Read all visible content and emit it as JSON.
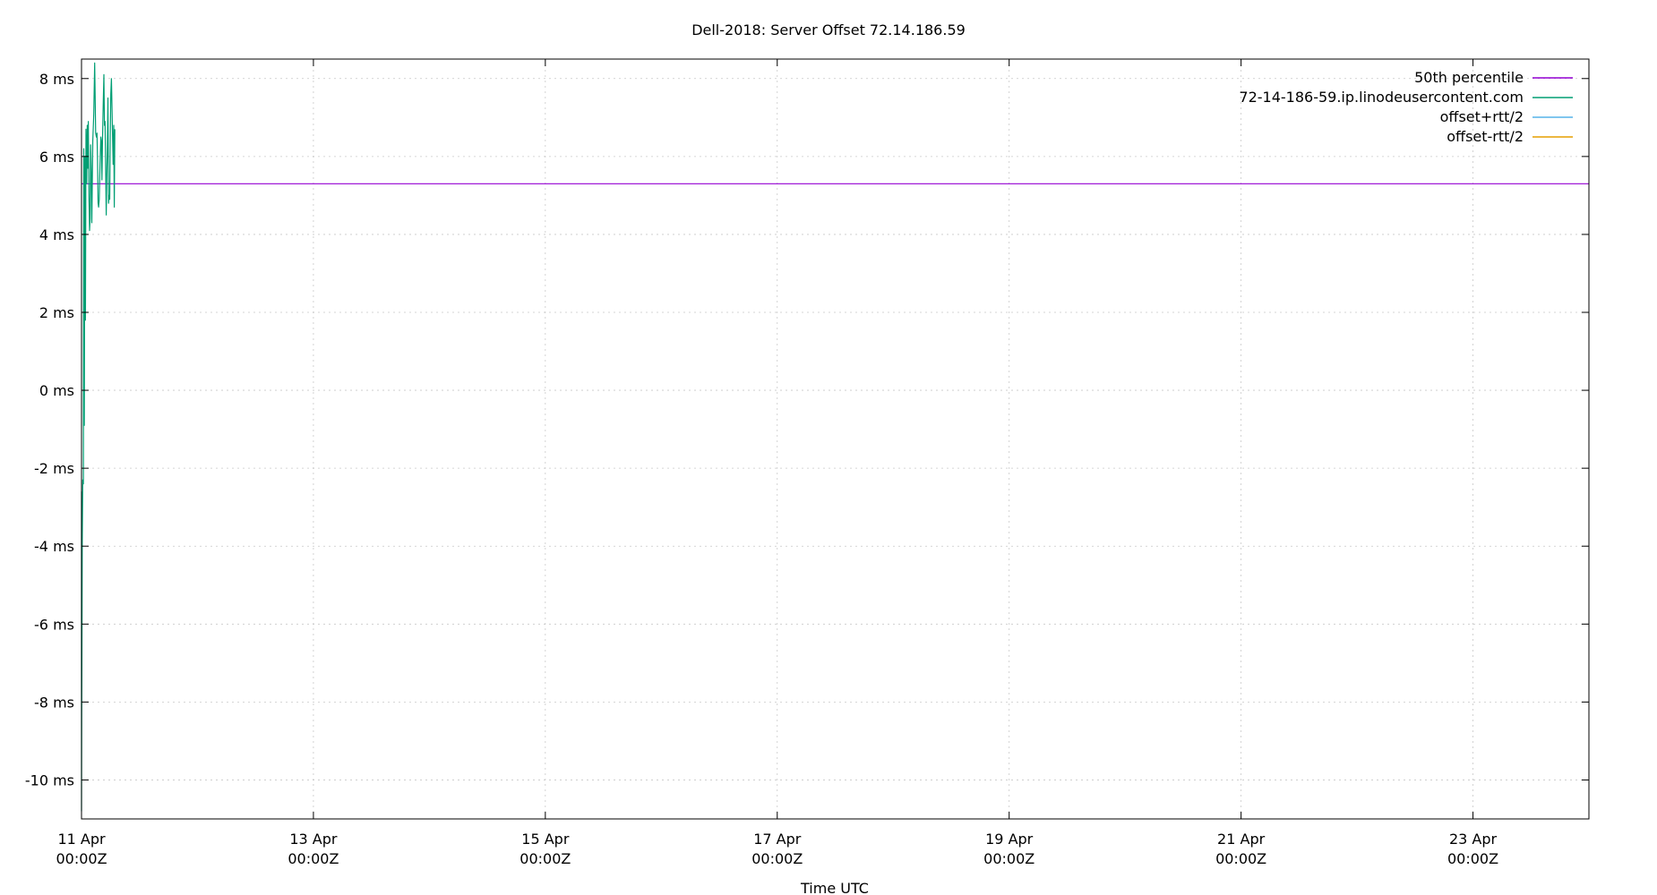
{
  "chart_data": {
    "type": "line",
    "title": "Dell-2018: Server Offset 72.14.186.59",
    "xlabel": "Time UTC",
    "ylabel": "",
    "xlim": [
      "2023-04-11 00:00",
      "2023-04-24 00:00"
    ],
    "ylim": [
      -11,
      8.5
    ],
    "grid": true,
    "legend_position": "top-right",
    "y_ticks": [
      {
        "value": 8,
        "label": "8 ms"
      },
      {
        "value": 6,
        "label": "6 ms"
      },
      {
        "value": 4,
        "label": "4 ms"
      },
      {
        "value": 2,
        "label": "2 ms"
      },
      {
        "value": 0,
        "label": "0 ms"
      },
      {
        "value": -2,
        "label": "-2 ms"
      },
      {
        "value": -4,
        "label": "-4 ms"
      },
      {
        "value": -6,
        "label": "-6 ms"
      },
      {
        "value": -8,
        "label": "-8 ms"
      },
      {
        "value": -10,
        "label": "-10 ms"
      }
    ],
    "x_ticks": [
      {
        "value": "2023-04-11 00:00",
        "line1": "11 Apr",
        "line2": "00:00Z"
      },
      {
        "value": "2023-04-13 00:00",
        "line1": "13 Apr",
        "line2": "00:00Z"
      },
      {
        "value": "2023-04-15 00:00",
        "line1": "15 Apr",
        "line2": "00:00Z"
      },
      {
        "value": "2023-04-17 00:00",
        "line1": "17 Apr",
        "line2": "00:00Z"
      },
      {
        "value": "2023-04-19 00:00",
        "line1": "19 Apr",
        "line2": "00:00Z"
      },
      {
        "value": "2023-04-21 00:00",
        "line1": "21 Apr",
        "line2": "00:00Z"
      },
      {
        "value": "2023-04-23 00:00",
        "line1": "23 Apr",
        "line2": "00:00Z"
      }
    ],
    "series": [
      {
        "name": "50th percentile",
        "color": "#9400d3",
        "style": "hline",
        "value": 5.3
      },
      {
        "name": "72-14-186-59.ip.linodeusercontent.com",
        "color": "#009e73",
        "style": "line",
        "points": [
          [
            "2023-04-10 22:58",
            -6.0
          ],
          [
            "2023-04-10 23:05",
            -8.6
          ],
          [
            "2023-04-10 23:12",
            -6.6
          ],
          [
            "2023-04-10 23:19",
            -3.4
          ],
          [
            "2023-04-10 23:26",
            -3.0
          ],
          [
            "2023-04-10 23:33",
            -2.6
          ],
          [
            "2023-04-10 23:40",
            -6.3
          ],
          [
            "2023-04-10 23:47",
            -6.5
          ],
          [
            "2023-04-10 23:54",
            -10.8
          ],
          [
            "2023-04-11 00:02",
            -8.5
          ],
          [
            "2023-04-11 00:09",
            -4.0
          ],
          [
            "2023-04-11 00:16",
            -2.3
          ],
          [
            "2023-04-11 00:23",
            -2.4
          ],
          [
            "2023-04-11 00:28",
            6.2
          ],
          [
            "2023-04-11 00:35",
            -0.9
          ],
          [
            "2023-04-11 00:42",
            6.0
          ],
          [
            "2023-04-11 00:49",
            1.8
          ],
          [
            "2023-04-11 00:56",
            6.7
          ],
          [
            "2023-04-11 01:04",
            5.3
          ],
          [
            "2023-04-11 01:11",
            6.8
          ],
          [
            "2023-04-11 01:18",
            5.7
          ],
          [
            "2023-04-11 01:25",
            6.9
          ],
          [
            "2023-04-11 01:32",
            5.0
          ],
          [
            "2023-04-11 01:40",
            4.1
          ],
          [
            "2023-04-11 01:47",
            4.4
          ],
          [
            "2023-04-11 01:54",
            6.3
          ],
          [
            "2023-04-11 02:01",
            5.6
          ],
          [
            "2023-04-11 02:08",
            4.3
          ],
          [
            "2023-04-11 02:20",
            6.4
          ],
          [
            "2023-04-11 02:32",
            7.1
          ],
          [
            "2023-04-11 02:44",
            8.4
          ],
          [
            "2023-04-11 02:56",
            6.6
          ],
          [
            "2023-04-11 03:05",
            6.5
          ],
          [
            "2023-04-11 03:12",
            6.6
          ],
          [
            "2023-04-11 03:19",
            5.9
          ],
          [
            "2023-04-11 03:26",
            4.8
          ],
          [
            "2023-04-11 03:33",
            4.7
          ],
          [
            "2023-04-11 03:40",
            4.9
          ],
          [
            "2023-04-11 03:50",
            5.8
          ],
          [
            "2023-04-11 04:00",
            6.5
          ],
          [
            "2023-04-11 04:07",
            6.4
          ],
          [
            "2023-04-11 04:14",
            5.4
          ],
          [
            "2023-04-11 04:21",
            6.5
          ],
          [
            "2023-04-11 04:30",
            7.4
          ],
          [
            "2023-04-11 04:38",
            8.1
          ],
          [
            "2023-04-11 04:45",
            6.8
          ],
          [
            "2023-04-11 04:52",
            6.9
          ],
          [
            "2023-04-11 05:00",
            5.6
          ],
          [
            "2023-04-11 05:07",
            4.5
          ],
          [
            "2023-04-11 05:14",
            5.5
          ],
          [
            "2023-04-11 05:21",
            6.3
          ],
          [
            "2023-04-11 05:28",
            7.5
          ],
          [
            "2023-04-11 05:36",
            4.8
          ],
          [
            "2023-04-11 05:43",
            5.0
          ],
          [
            "2023-04-11 05:50",
            4.9
          ],
          [
            "2023-04-11 05:57",
            6.5
          ],
          [
            "2023-04-11 06:04",
            7.6
          ],
          [
            "2023-04-11 06:12",
            8.0
          ],
          [
            "2023-04-11 06:33",
            5.8
          ],
          [
            "2023-04-11 06:40",
            6.8
          ],
          [
            "2023-04-11 06:47",
            4.7
          ],
          [
            "2023-04-11 06:54",
            6.7
          ]
        ]
      },
      {
        "name": "offset+rtt/2",
        "color": "#56b4e9",
        "style": "legend-only"
      },
      {
        "name": "offset-rtt/2",
        "color": "#e69f00",
        "style": "legend-only"
      }
    ]
  }
}
